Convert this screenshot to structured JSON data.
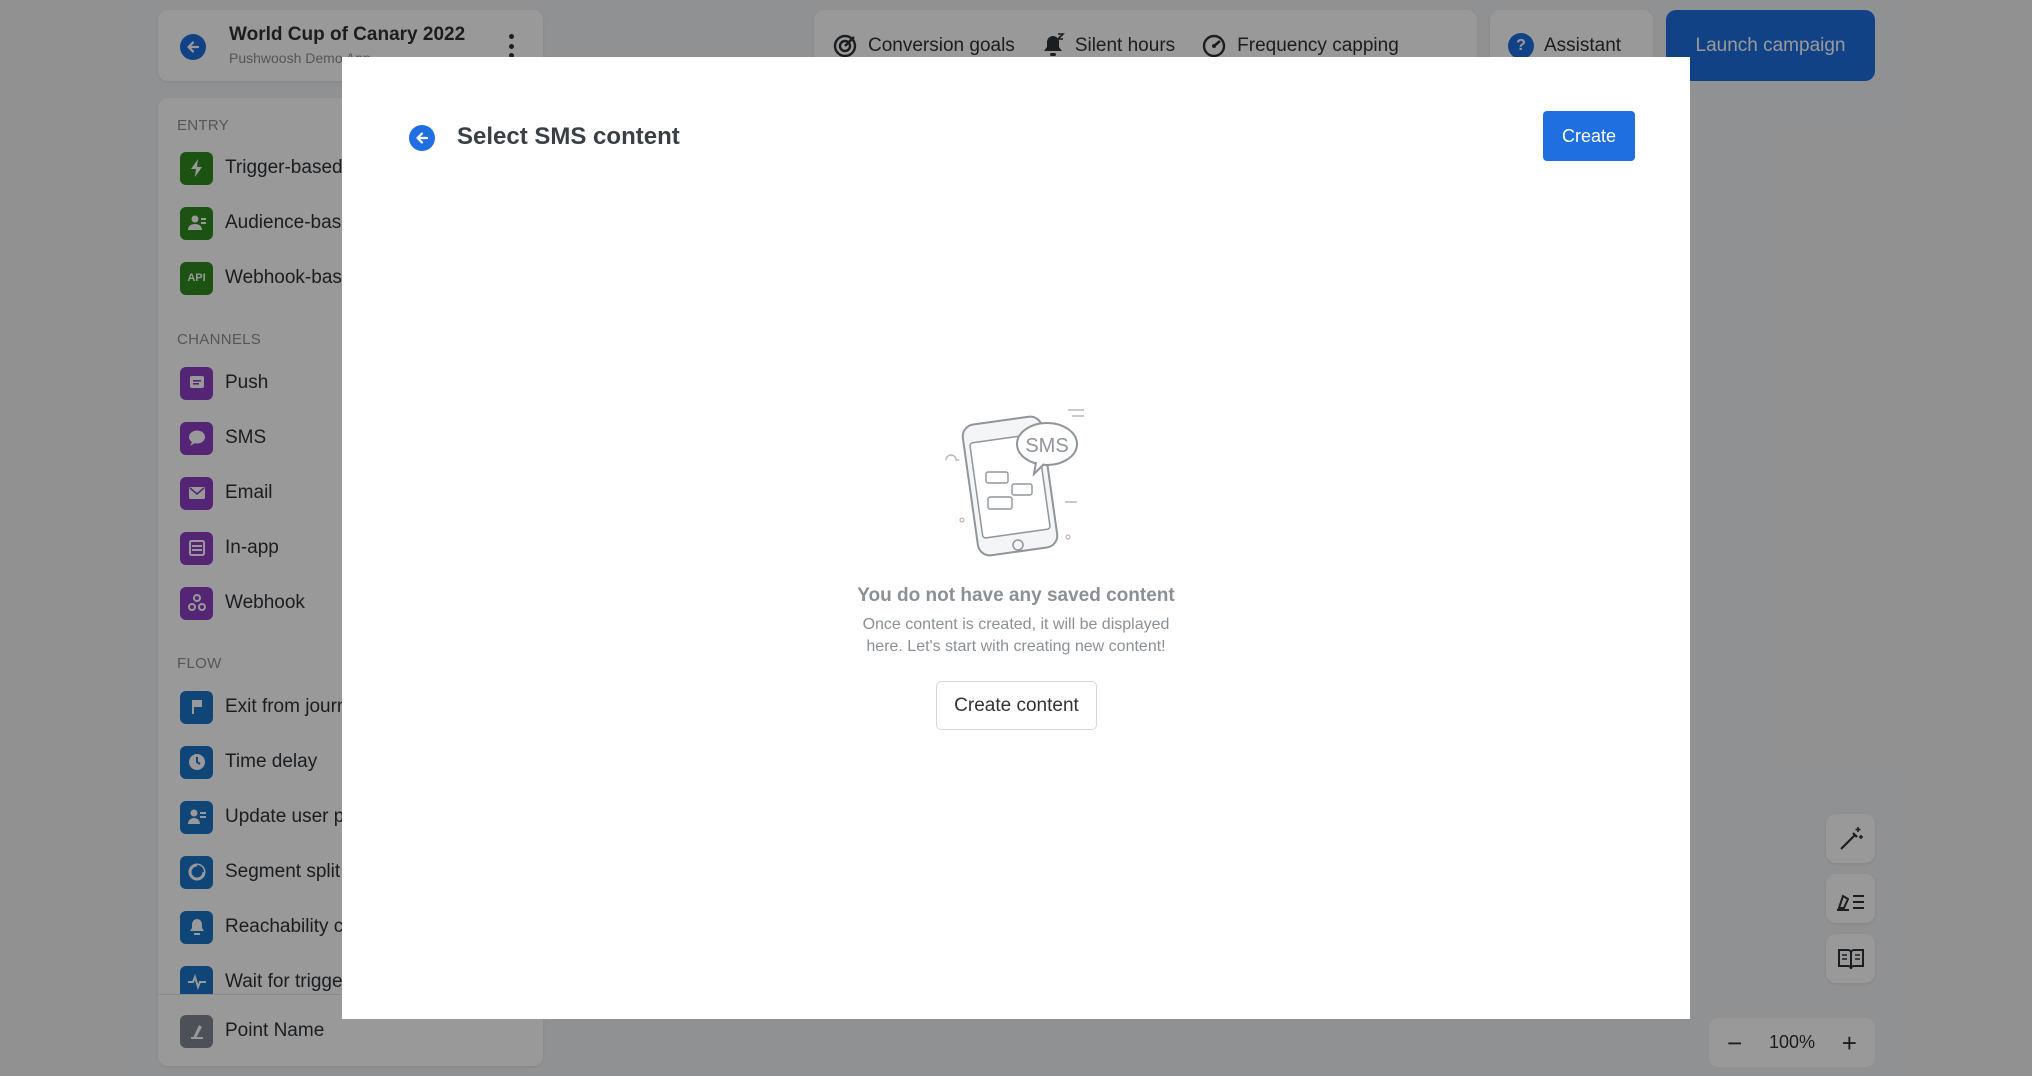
{
  "header": {
    "title": "World Cup of Canary 2022",
    "subtitle": "Pushwoosh Demo App",
    "back_icon": "arrow-left-icon",
    "menu_icon": "kebab-menu-icon"
  },
  "sidebar": {
    "sections": [
      {
        "title": "ENTRY",
        "items": [
          {
            "label": "Trigger-based",
            "icon": "bolt-icon"
          },
          {
            "label": "Audience-based",
            "icon": "audience-icon"
          },
          {
            "label": "Webhook-based",
            "icon": "api-icon",
            "badge": "API"
          }
        ]
      },
      {
        "title": "CHANNELS",
        "items": [
          {
            "label": "Push",
            "icon": "push-icon"
          },
          {
            "label": "SMS",
            "icon": "sms-icon"
          },
          {
            "label": "Email",
            "icon": "email-icon"
          },
          {
            "label": "In-app",
            "icon": "in-app-icon"
          },
          {
            "label": "Webhook",
            "icon": "webhook-icon"
          }
        ]
      },
      {
        "title": "FLOW",
        "items": [
          {
            "label": "Exit from journey",
            "icon": "flag-icon"
          },
          {
            "label": "Time delay",
            "icon": "clock-icon"
          },
          {
            "label": "Update user profile",
            "icon": "user-update-icon"
          },
          {
            "label": "Segment split",
            "icon": "split-icon"
          },
          {
            "label": "Reachability check",
            "icon": "reachability-icon"
          },
          {
            "label": "Wait for trigger",
            "icon": "pulse-icon"
          }
        ]
      }
    ],
    "point_item": {
      "label": "Point Name",
      "icon": "point-icon"
    }
  },
  "toolbar": {
    "conversion_goals": "Conversion goals",
    "silent_hours": "Silent hours",
    "frequency_capping": "Frequency capping",
    "assistant": "Assistant",
    "launch": "Launch campaign"
  },
  "zoom": {
    "level": "100%",
    "minus": "−",
    "plus": "+"
  },
  "tools": [
    "magic-wand-icon",
    "edit-list-icon",
    "book-icon"
  ],
  "modal": {
    "title": "Select SMS content",
    "create_label": "Create",
    "empty_illustration_text": "SMS",
    "empty_title": "You do not have any saved content",
    "empty_text_line1": "Once content is created, it will be displayed",
    "empty_text_line2": "here. Let's start with creating new content!",
    "create_content_label": "Create content"
  },
  "colors": {
    "accent": "#1f6fe0",
    "entry": "#2f8a1f",
    "channel": "#8a3fc2",
    "flow": "#1c74c8"
  }
}
